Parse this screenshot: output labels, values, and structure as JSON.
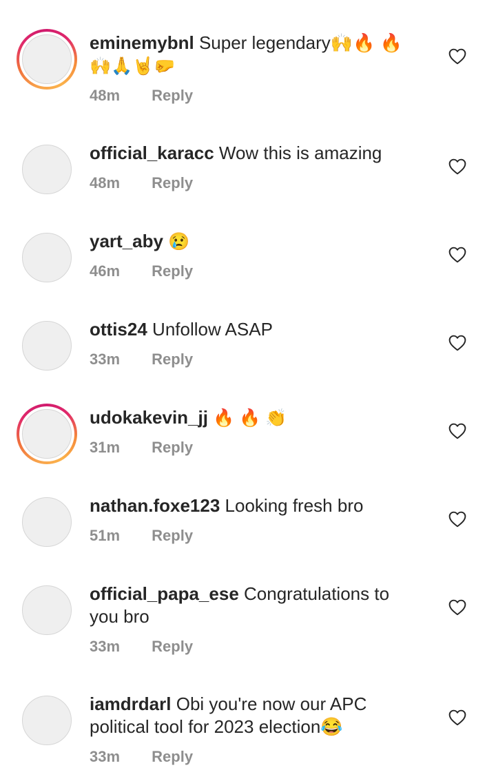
{
  "comments": [
    {
      "username": "eminemybnl",
      "text": "Super legendary🙌🔥 🔥",
      "text2": "🙌🙏🤘🤛",
      "time": "48m",
      "reply": "Reply",
      "story": true
    },
    {
      "username": "official_karacc",
      "text": "Wow this is amazing",
      "time": "48m",
      "reply": "Reply",
      "story": false
    },
    {
      "username": "yart_aby",
      "text": "😢",
      "time": "46m",
      "reply": "Reply",
      "story": false
    },
    {
      "username": "ottis24",
      "text": "Unfollow ASAP",
      "time": "33m",
      "reply": "Reply",
      "story": false
    },
    {
      "username": "udokakevin_jj",
      "text": "🔥 🔥 👏",
      "time": "31m",
      "reply": "Reply",
      "story": true
    },
    {
      "username": "nathan.foxe123",
      "text": "Looking fresh bro",
      "time": "51m",
      "reply": "Reply",
      "story": false
    },
    {
      "username": "official_papa_ese",
      "text": "Congratulations to you bro",
      "time": "33m",
      "reply": "Reply",
      "story": false
    },
    {
      "username": "iamdrdarl",
      "text": "Obi you're now our APC political tool for 2023 election😂",
      "time": "33m",
      "reply": "Reply",
      "story": false
    }
  ],
  "icons": {
    "like": "heart-outline-icon"
  },
  "colors": {
    "story_ring_start": "#f8a24b",
    "story_ring_end": "#d01a6d",
    "meta": "#8e8e8e"
  }
}
